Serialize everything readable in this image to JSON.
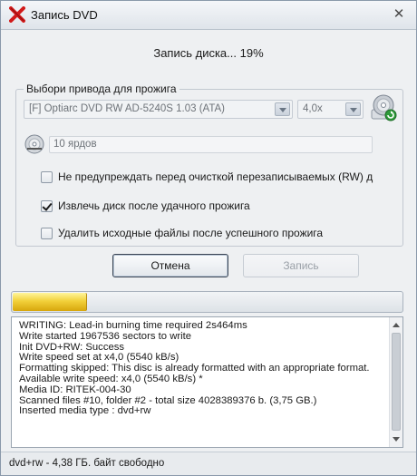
{
  "window": {
    "title": "Запись DVD",
    "close_glyph": "✕"
  },
  "status": {
    "text": "Запись диска... 19%",
    "progress_fraction": 0.19
  },
  "drive_group": {
    "legend": "Выбори привода для прожига",
    "drive": "[F] Optiarc DVD RW AD-5240S 1.03 (ATA)",
    "speed": "4,0x",
    "copies": "10 ярдов"
  },
  "options": [
    {
      "label": "Не предупреждать перед очисткой перезаписываемых (RW) д",
      "checked": false
    },
    {
      "label": "Извлечь диск после удачного прожига",
      "checked": true
    },
    {
      "label": "Удалить исходные файлы после успешного прожига",
      "checked": false
    }
  ],
  "buttons": {
    "cancel": "Отмена",
    "write": "Запись"
  },
  "log": [
    "WRITING: Lead-in burning time required 2s464ms",
    "Write started 1967536 sectors to write",
    "Init DVD+RW: Success",
    "Write speed set at x4,0 (5540 kB/s)",
    "Formatting skipped: This disc is already formatted with an appropriate format.",
    "Available write speed: x4,0 (5540 kB/s) *",
    "Media ID: RITEK-004-30",
    "Scanned files #10, folder #2 - total size 4028389376 b. (3,75 GB.)",
    "Inserted media type : dvd+rw"
  ],
  "statusbar": {
    "text": "dvd+rw - 4,38 ГБ. байт свободно"
  },
  "icons": {
    "app": "red-x-icon",
    "burn": "disc-burn-icon",
    "disc": "disc-icon"
  },
  "colors": {
    "progress": "#f2d13a",
    "app_icon": "#d21a1a"
  }
}
